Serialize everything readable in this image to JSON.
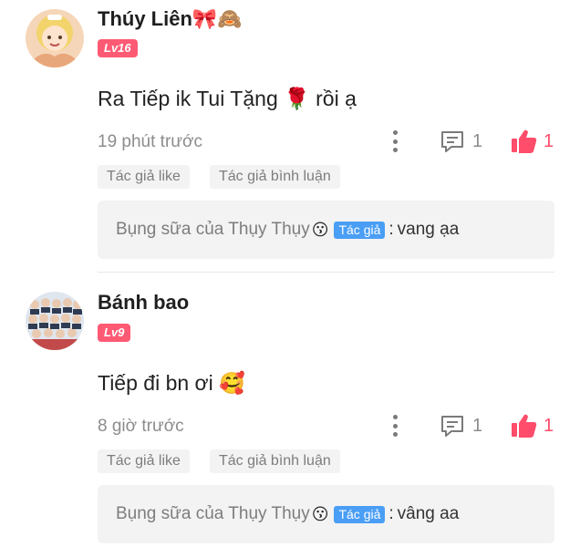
{
  "comments": [
    {
      "username": "Thúy Liên🎀🙈",
      "level": "Lv16",
      "text": "Ra Tiếp ik Tui Tặng 🌹 rồi ạ",
      "time": "19 phút trước",
      "reply_count": "1",
      "like_count": "1",
      "tags": [
        "Tác giả like",
        "Tác giả bình luận"
      ],
      "reply": {
        "author": "Bụng sữa của Thụy Thụy",
        "emoji": "😗",
        "badge": "Tác giả",
        "colon": ":",
        "content": "vang ạa"
      }
    },
    {
      "username": "Bánh bao",
      "level": "Lv9",
      "text": "Tiếp đi bn ơi 🥰",
      "time": "8 giờ trước",
      "reply_count": "1",
      "like_count": "1",
      "tags": [
        "Tác giả like",
        "Tác giả bình luận"
      ],
      "reply": {
        "author": "Bụng sữa của Thụy Thụy",
        "emoji": "😗",
        "badge": "Tác giả",
        "colon": ":",
        "content": "vâng aa"
      }
    }
  ],
  "icons": {
    "more": "more-vertical-icon",
    "reply": "comment-bubble-icon",
    "like": "thumbs-up-icon"
  },
  "colors": {
    "level_badge": "#ff5a74",
    "like": "#ff4d6b",
    "author_badge": "#4a9ef5",
    "muted_text": "#8c8c8c",
    "tag_bg": "#f3f3f3"
  }
}
